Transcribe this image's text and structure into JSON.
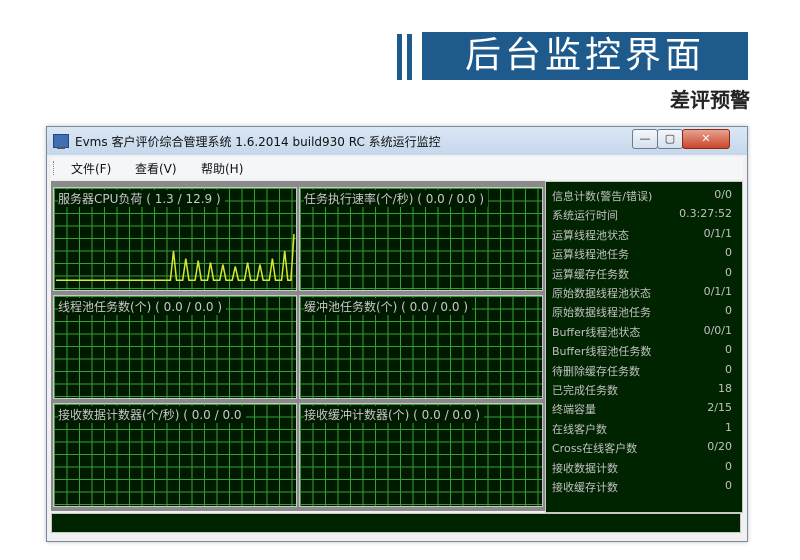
{
  "banner": {
    "title": "后台监控界面",
    "subtitle": "差评预警"
  },
  "window": {
    "title": "Evms 客户评价综合管理系统 1.6.2014 build930 RC 系统运行监控",
    "controls": {
      "minimize": "—",
      "maximize": "▢",
      "close": "✕"
    }
  },
  "menu": [
    "文件(F)",
    "查看(V)",
    "帮助(H)"
  ],
  "panels": {
    "cpu": "服务器CPU负荷 ( 1.3 / 12.9 )",
    "task_rate": "任务执行速率(个/秒) ( 0.0 / 0.0 )",
    "pool_tasks": "线程池任务数(个) ( 0.0 / 0.0 )",
    "buffer_tasks": "缓冲池任务数(个) ( 0.0 / 0.0 )",
    "recv_data": "接收数据计数器(个/秒) ( 0.0 / 0.0",
    "recv_buffer": "接收缓冲计数器(个) ( 0.0 / 0.0 )"
  },
  "info": [
    {
      "k": "信息计数(警告/错误)",
      "v": "0/0"
    },
    {
      "k": "系统运行时间",
      "v": "0.3:27:52"
    },
    {
      "k": "运算线程池状态",
      "v": "0/1/1"
    },
    {
      "k": "运算线程池任务",
      "v": "0"
    },
    {
      "k": "运算缓存任务数",
      "v": "0"
    },
    {
      "k": "原始数据线程池状态",
      "v": "0/1/1"
    },
    {
      "k": "原始数据线程池任务",
      "v": "0"
    },
    {
      "k": "Buffer线程池状态",
      "v": "0/0/1"
    },
    {
      "k": "Buffer线程池任务数",
      "v": "0"
    },
    {
      "k": "待删除缓存任务数",
      "v": "0"
    },
    {
      "k": "已完成任务数",
      "v": "18"
    },
    {
      "k": "终端容量",
      "v": "2/15"
    },
    {
      "k": "在线客户数",
      "v": "1"
    },
    {
      "k": "Cross在线客户数",
      "v": "0/20"
    },
    {
      "k": "接收数据计数",
      "v": "0"
    },
    {
      "k": "接收缓存计数",
      "v": "0"
    }
  ],
  "cpu_chart": {
    "ylim": [
      0,
      100
    ],
    "values": [
      8,
      8,
      8,
      8,
      8,
      8,
      8,
      8,
      8,
      8,
      8,
      8,
      8,
      8,
      8,
      8,
      8,
      8,
      8,
      8,
      8,
      8,
      8,
      8,
      8,
      8,
      8,
      8,
      8,
      8,
      8,
      8,
      8,
      8,
      8,
      8,
      8,
      8,
      38,
      8,
      8,
      8,
      30,
      8,
      8,
      8,
      28,
      8,
      8,
      8,
      26,
      8,
      8,
      8,
      24,
      8,
      8,
      8,
      22,
      8,
      8,
      8,
      26,
      8,
      8,
      8,
      24,
      8,
      8,
      8,
      30,
      8,
      8,
      8,
      38,
      8,
      8,
      55
    ],
    "line_color": "#d8e830"
  },
  "colors": {
    "banner": "#1e5a8c",
    "grid": "#3aa63a",
    "panel_bg": "#001a00"
  }
}
